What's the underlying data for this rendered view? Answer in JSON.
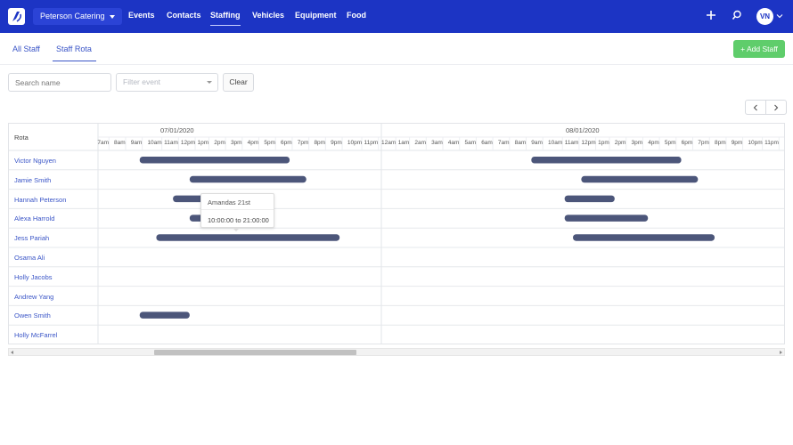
{
  "navbar": {
    "logo_icon": "logo-icon",
    "company": "Peterson Catering",
    "links": [
      "Events",
      "Contacts",
      "Staffing",
      "Vehicles",
      "Equipment",
      "Food"
    ],
    "active_link": "Staffing",
    "add_icon": "plus-icon",
    "search_icon": "search-icon",
    "avatar_initials": "VN",
    "avatar_caret_icon": "chevron-down-icon"
  },
  "subtabs": {
    "items": [
      "All Staff",
      "Staff Rota"
    ],
    "active": "Staff Rota"
  },
  "add_staff_label": "+ Add Staff",
  "filters": {
    "search_placeholder": "Search name",
    "event_placeholder": "Filter event",
    "clear_label": "Clear"
  },
  "pager": {
    "prev_icon": "chevron-left-icon",
    "next_icon": "chevron-right-icon"
  },
  "rota": {
    "header_label": "Rota",
    "dates": [
      "07/01/2020",
      "08/01/2020"
    ],
    "day1_hours": [
      "7am",
      "8am",
      "9am",
      "10am",
      "11am",
      "12pm",
      "1pm",
      "2pm",
      "3pm",
      "4pm",
      "5pm",
      "6pm",
      "7pm",
      "8pm",
      "9pm",
      "10pm",
      "11pm"
    ],
    "day2_hours": [
      "12am",
      "1am",
      "2am",
      "3am",
      "4am",
      "5am",
      "6am",
      "7am",
      "8am",
      "9am",
      "10am",
      "11am",
      "12pm",
      "1pm",
      "2pm",
      "3pm",
      "4pm",
      "5pm",
      "6pm",
      "7pm",
      "8pm",
      "9pm",
      "10pm",
      "11pm"
    ],
    "staff": [
      "Victor Nguyen",
      "Jamie Smith",
      "Hannah Peterson",
      "Alexa Harrold",
      "Jess Pariah",
      "Osama Ali",
      "Holly Jacobs",
      "Andrew Yang",
      "Owen Smith",
      "Holly McFarrel"
    ]
  },
  "tooltip": {
    "title": "Amandas 21st",
    "time": "10:00:00 to 21:00:00"
  },
  "colors": {
    "nav_bg": "#1c34c4",
    "accent": "#3a55c7",
    "shift_bar": "#4c567a",
    "add_button": "#5fcd6b"
  },
  "chart_data": {
    "type": "gantt",
    "series": [
      {
        "staff": "Victor Nguyen",
        "date": "07/01/2020",
        "start": 9.0,
        "end": 18.0
      },
      {
        "staff": "Victor Nguyen",
        "date": "08/01/2020",
        "start": 9.0,
        "end": 18.0
      },
      {
        "staff": "Jamie Smith",
        "date": "07/01/2020",
        "start": 12.0,
        "end": 19.0
      },
      {
        "staff": "Jamie Smith",
        "date": "08/01/2020",
        "start": 12.0,
        "end": 19.0
      },
      {
        "staff": "Hannah Peterson",
        "date": "07/01/2020",
        "start": 11.0,
        "end": 13.0
      },
      {
        "staff": "Hannah Peterson",
        "date": "08/01/2020",
        "start": 11.0,
        "end": 14.0
      },
      {
        "staff": "Alexa Harrold",
        "date": "07/01/2020",
        "start": 12.0,
        "end": 13.5
      },
      {
        "staff": "Alexa Harrold",
        "date": "08/01/2020",
        "start": 11.0,
        "end": 16.0
      },
      {
        "staff": "Jess Pariah",
        "date": "07/01/2020",
        "start": 10.0,
        "end": 21.0
      },
      {
        "staff": "Jess Pariah",
        "date": "08/01/2020",
        "start": 11.5,
        "end": 20.0
      },
      {
        "staff": "Owen Smith",
        "date": "07/01/2020",
        "start": 9.0,
        "end": 12.0
      }
    ]
  }
}
